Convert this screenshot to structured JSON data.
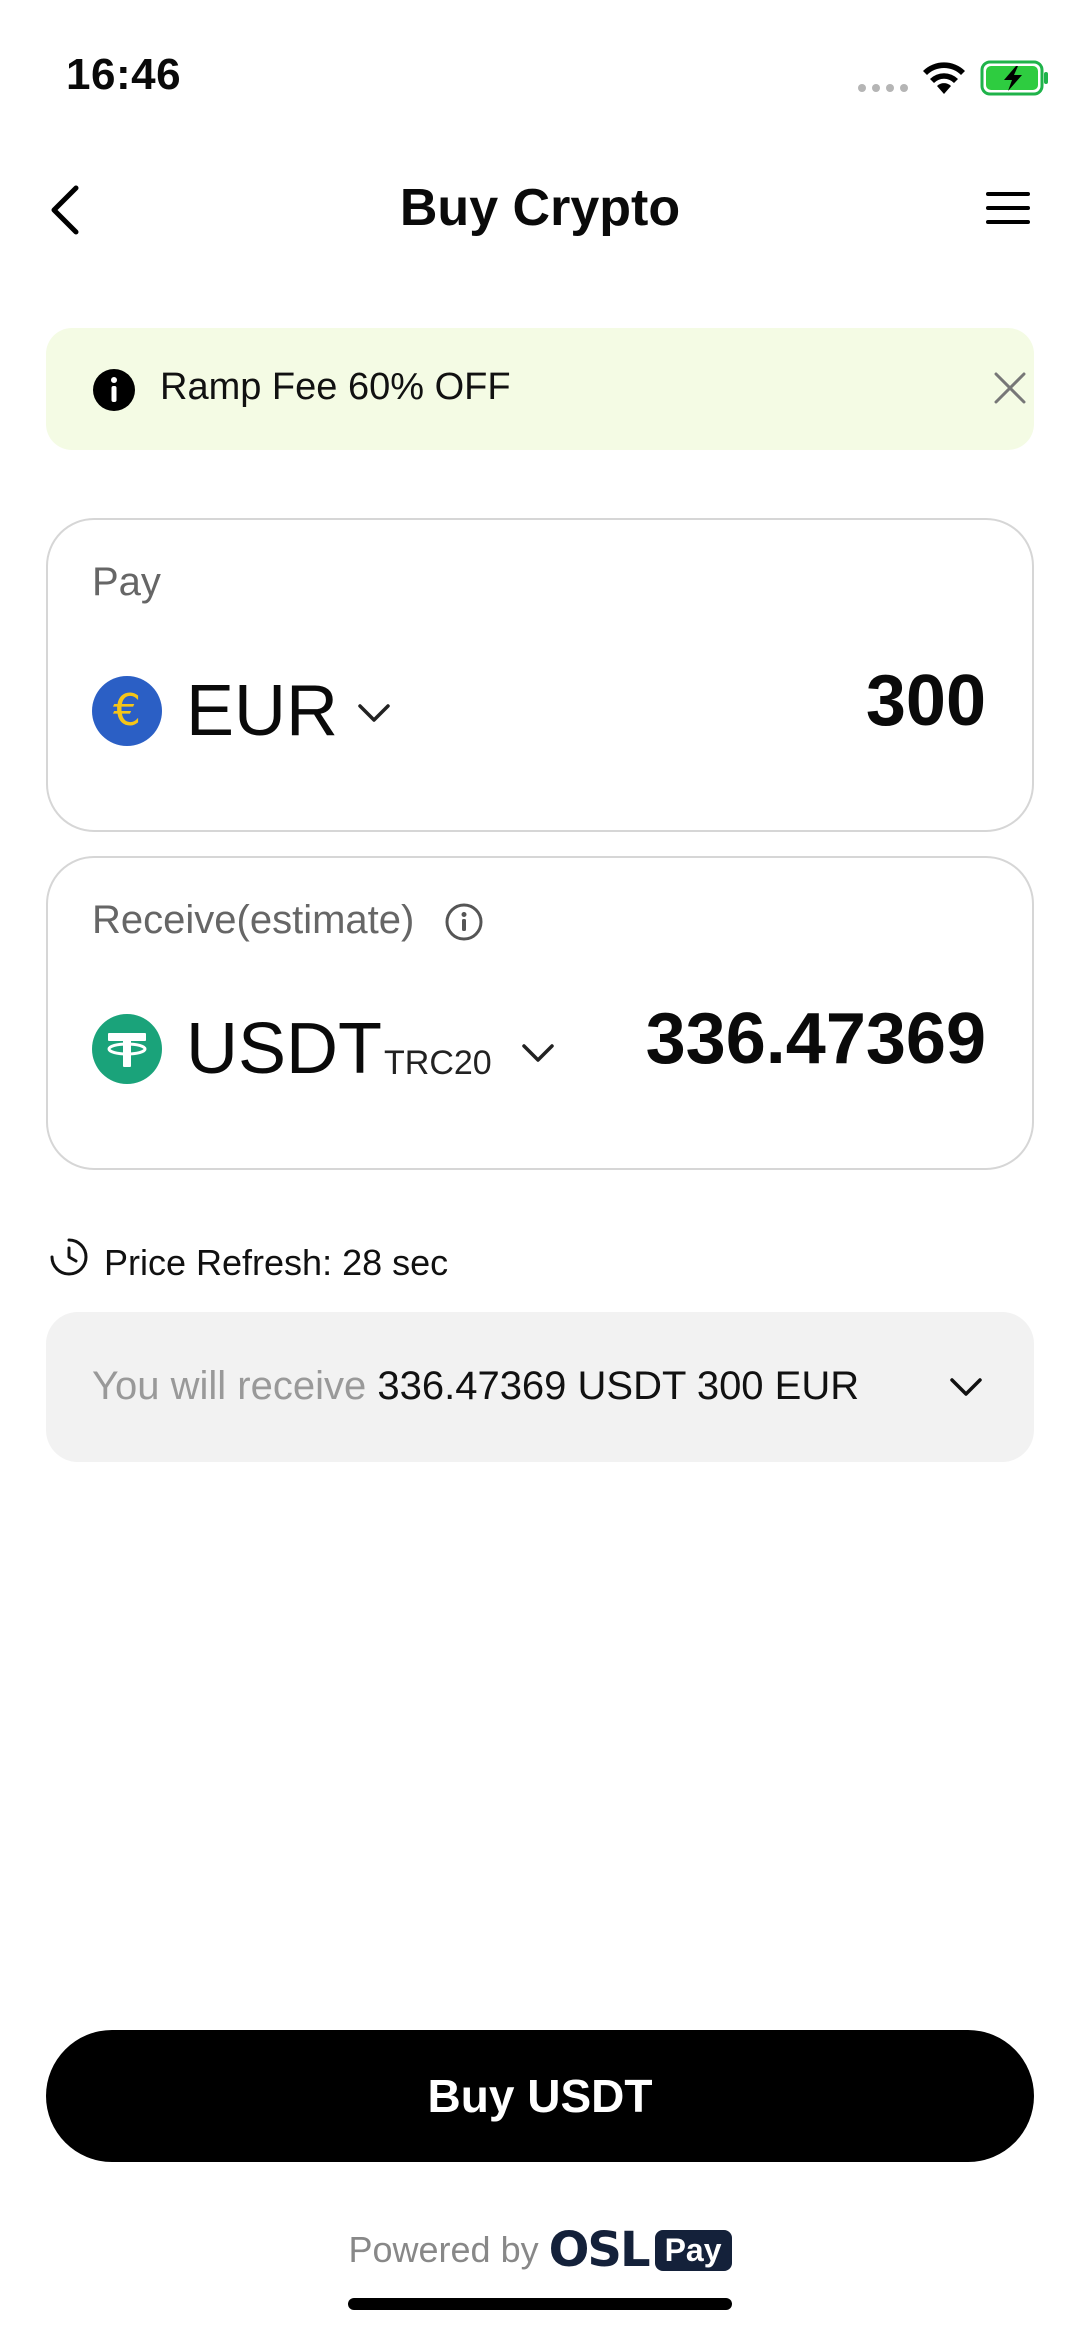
{
  "status_bar": {
    "time": "16:46"
  },
  "header": {
    "title": "Buy Crypto"
  },
  "banner": {
    "text": "Ramp Fee 60% OFF"
  },
  "pay": {
    "label": "Pay",
    "currency": "EUR",
    "currency_symbol": "€",
    "amount": "300"
  },
  "receive": {
    "label": "Receive(estimate)",
    "currency": "USDT",
    "network": "TRC20",
    "amount": "336.47369"
  },
  "price_refresh": {
    "text": "Price Refresh: 28 sec"
  },
  "summary": {
    "prefix": "You will receive",
    "value": "336.47369 USDT 300 EUR"
  },
  "buy_button": {
    "label": "Buy USDT"
  },
  "footer": {
    "powered_by": "Powered by",
    "brand": "OSL",
    "badge": "Pay"
  },
  "colors": {
    "eur_coin": "#2b5fc5",
    "eur_symbol": "#f5c518",
    "usdt_coin": "#1aa37a",
    "banner_bg": "#f4fbe4",
    "button_bg": "#000000"
  }
}
